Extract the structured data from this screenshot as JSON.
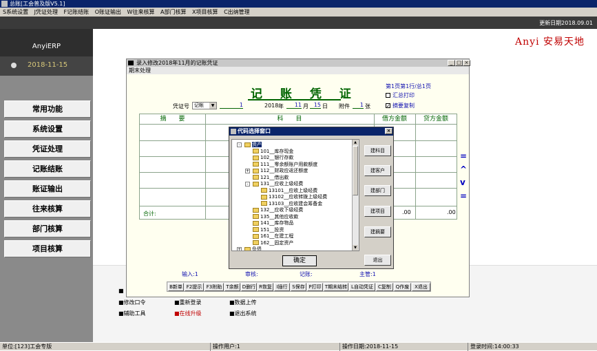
{
  "app": {
    "title": "总账[工会普及版V5.1]",
    "update_date": "更新日期2018.09.01",
    "brand": "Anyi 安易天地"
  },
  "menu": [
    "S系统设置",
    "J凭证处理",
    "F记账结账",
    "O账证输出",
    "W往来核算",
    "A部门核算",
    "X项目核算",
    "C出纳管理"
  ],
  "sidebar": {
    "erp_label": "AnyiERP",
    "date": "2018-11-15",
    "items": [
      "常用功能",
      "系统设置",
      "凭证处理",
      "记账结账",
      "账证输出",
      "往来核算",
      "部门核算",
      "项目核算"
    ]
  },
  "extras": {
    "row1": [
      "■修改口令",
      "■重新登录",
      "■数据上传"
    ],
    "row2": [
      "■辅助工具",
      "■在线升级",
      "■退出系统"
    ],
    "row0": [
      "■",
      "■",
      "■"
    ]
  },
  "statusbar": {
    "unit": "单位:[123]工会专版",
    "user": "操作用户:1",
    "op_date": "操作日期:2018-11-15",
    "login_time": "登录时间:14:00:33"
  },
  "voucher": {
    "window_title": "录入修改2018年11月的记账凭证",
    "menu": "期末处理",
    "heading": "记 账 凭 证",
    "page_info": "第1页第1行/总1页",
    "summary_print": "汇总打印",
    "summary_copy": "摘要复制",
    "summary_copy_checked": true,
    "summary_print_checked": false,
    "voucher_no_label": "凭证号",
    "voucher_type": "记帐",
    "voucher_no": "1",
    "year": "2018",
    "year_label": "年",
    "month": "11",
    "month_label": "月",
    "day": "15",
    "day_label": "日",
    "attach_label": "附件",
    "attach_count": "1",
    "attach_unit": "张",
    "columns": [
      "摘　　要",
      "科　　目",
      "借方金额",
      "贷方金额"
    ],
    "total_label": "合计:",
    "debit_total": ".00",
    "credit_total": ".00",
    "side_marks": [
      "=",
      "^",
      "v",
      "="
    ],
    "footer": {
      "input": "输入:1",
      "review": "审核:",
      "post": "记账:",
      "manager": "主管:1"
    },
    "toolbar": [
      "B新单",
      "F2提示",
      "F3附助",
      "T余额",
      "D删行",
      "R恢复",
      "I插行",
      "S保存",
      "P打印",
      "T期末结转",
      "L自动凭证",
      "C复制",
      "Q作废",
      "X退出"
    ]
  },
  "code_window": {
    "title": "代码选择窗口",
    "tree": [
      {
        "label": "资产",
        "level": 0,
        "expand": "-",
        "selected": true
      },
      {
        "label": "101__库存现金",
        "level": 1
      },
      {
        "label": "102__银行存款",
        "level": 1
      },
      {
        "label": "111__零余额账户用款额度",
        "level": 1
      },
      {
        "label": "112__财政应返还额度",
        "level": 1,
        "expand": "+"
      },
      {
        "label": "121__借出款",
        "level": 1
      },
      {
        "label": "131__应收上级经费",
        "level": 1,
        "expand": "-"
      },
      {
        "label": "13101__应收上级经费",
        "level": 2
      },
      {
        "label": "13102__应收转拨上级经费",
        "level": 2
      },
      {
        "label": "13103__应收建会筹备金",
        "level": 2
      },
      {
        "label": "132__应收下级经费",
        "level": 1
      },
      {
        "label": "135__其他应收款",
        "level": 1
      },
      {
        "label": "141__库存物品",
        "level": 1
      },
      {
        "label": "151__投资",
        "level": 1
      },
      {
        "label": "161__在建工程",
        "level": 1
      },
      {
        "label": "162__固定资产",
        "level": 1
      },
      {
        "label": "负债",
        "level": 0,
        "expand": "+"
      }
    ],
    "buttons": [
      "建科目",
      "建客户",
      "建部门",
      "建项目",
      "建摘要"
    ],
    "exit_button": "退出",
    "ok_button": "确定"
  }
}
